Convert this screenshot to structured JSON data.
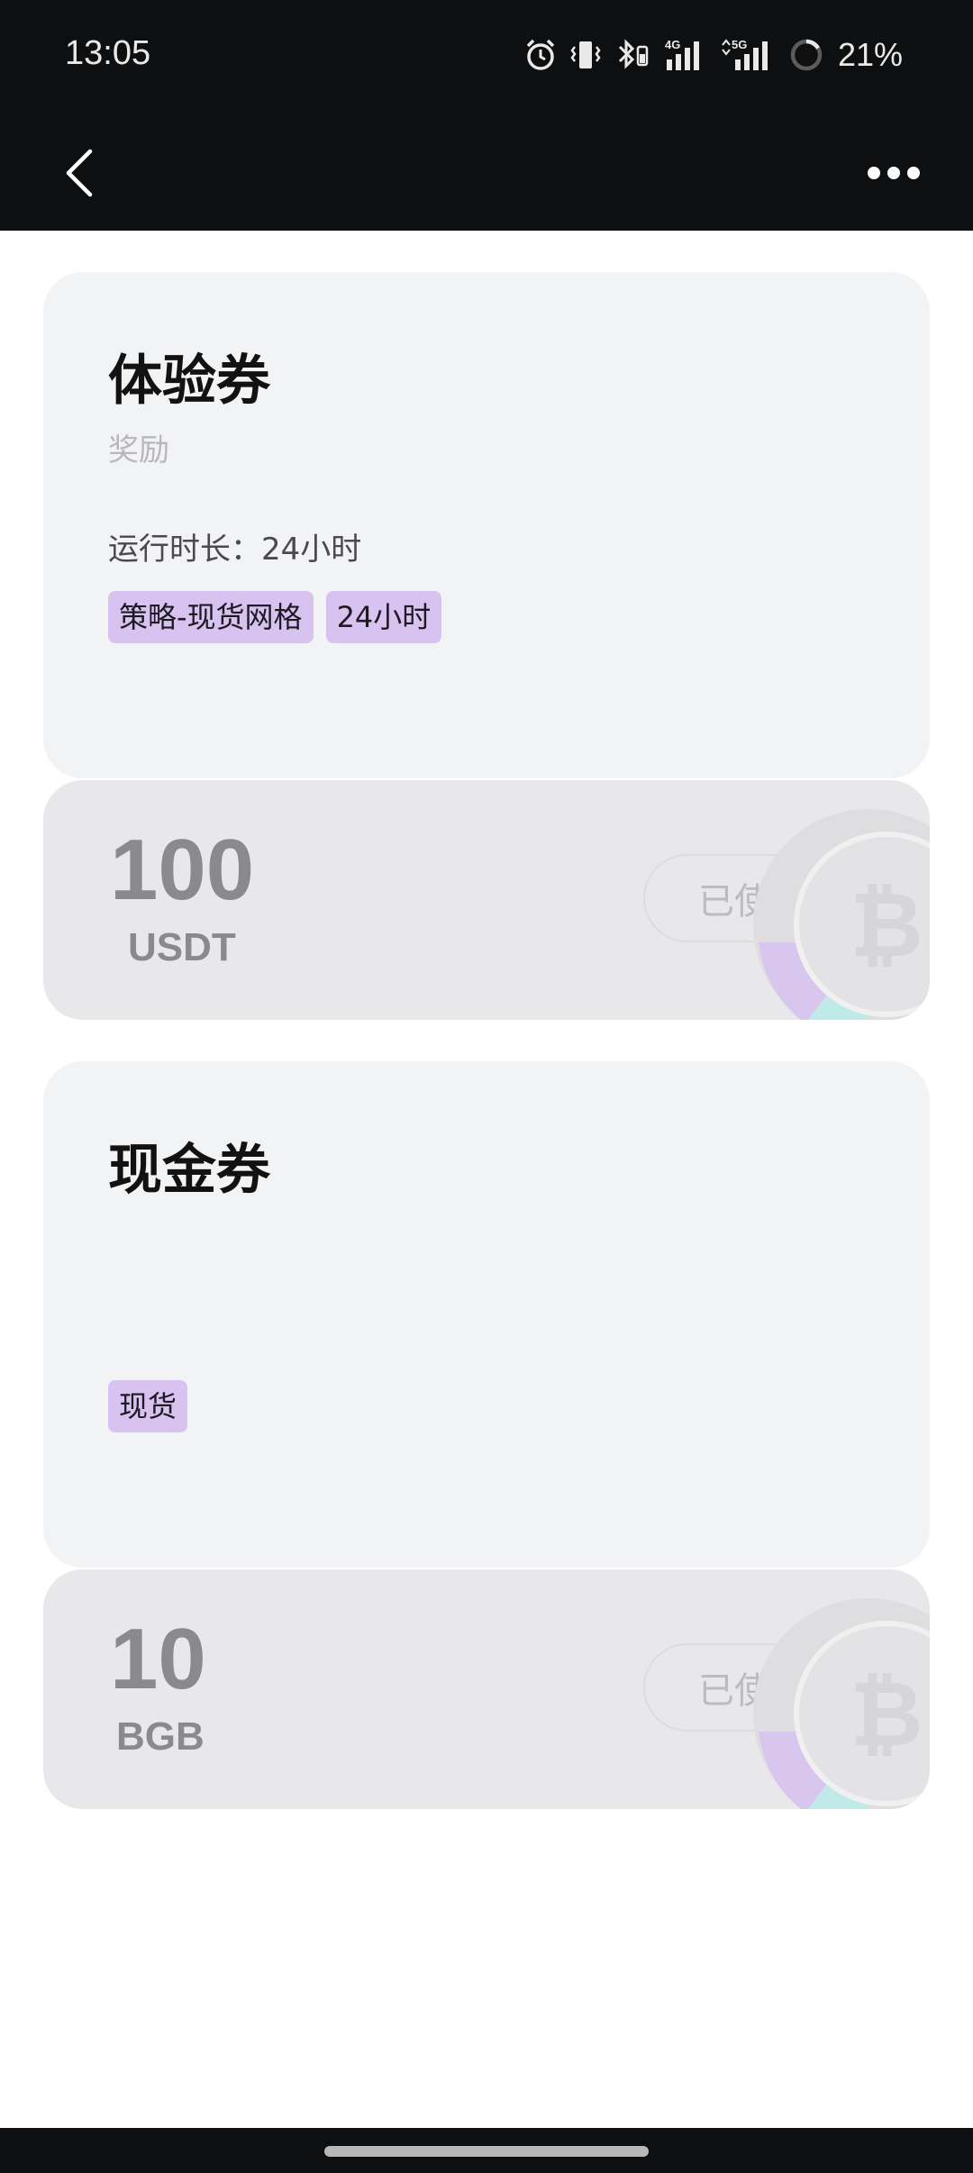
{
  "status_bar": {
    "time": "13:05",
    "battery": "21%",
    "icons": [
      "alarm-icon",
      "vibrate-icon",
      "bluetooth-icon",
      "signal-4g-icon",
      "signal-5g-icon",
      "battery-ring-icon"
    ],
    "network_labels": {
      "first": "4G",
      "second": "5G"
    }
  },
  "nav": {
    "back_icon": "chevron-left-icon",
    "more_icon": "more-horizontal-icon"
  },
  "coupons": [
    {
      "title": "体验券",
      "subtitle": "奖励",
      "duration": "运行时长：24小时",
      "tags": [
        "策略-现货网格",
        "24小时"
      ],
      "amount": "100",
      "unit": "USDT",
      "status_label": "已使用"
    },
    {
      "title": "现金券",
      "subtitle": "",
      "duration": "",
      "tags": [
        "现货"
      ],
      "amount": "10",
      "unit": "BGB",
      "status_label": "已使用"
    }
  ],
  "colors": {
    "header_bg": "#0e0f10",
    "card_top_bg": "#f2f3f5",
    "card_bottom_bg": "#e8e8ea",
    "tag_bg": "#d8c2f0"
  }
}
